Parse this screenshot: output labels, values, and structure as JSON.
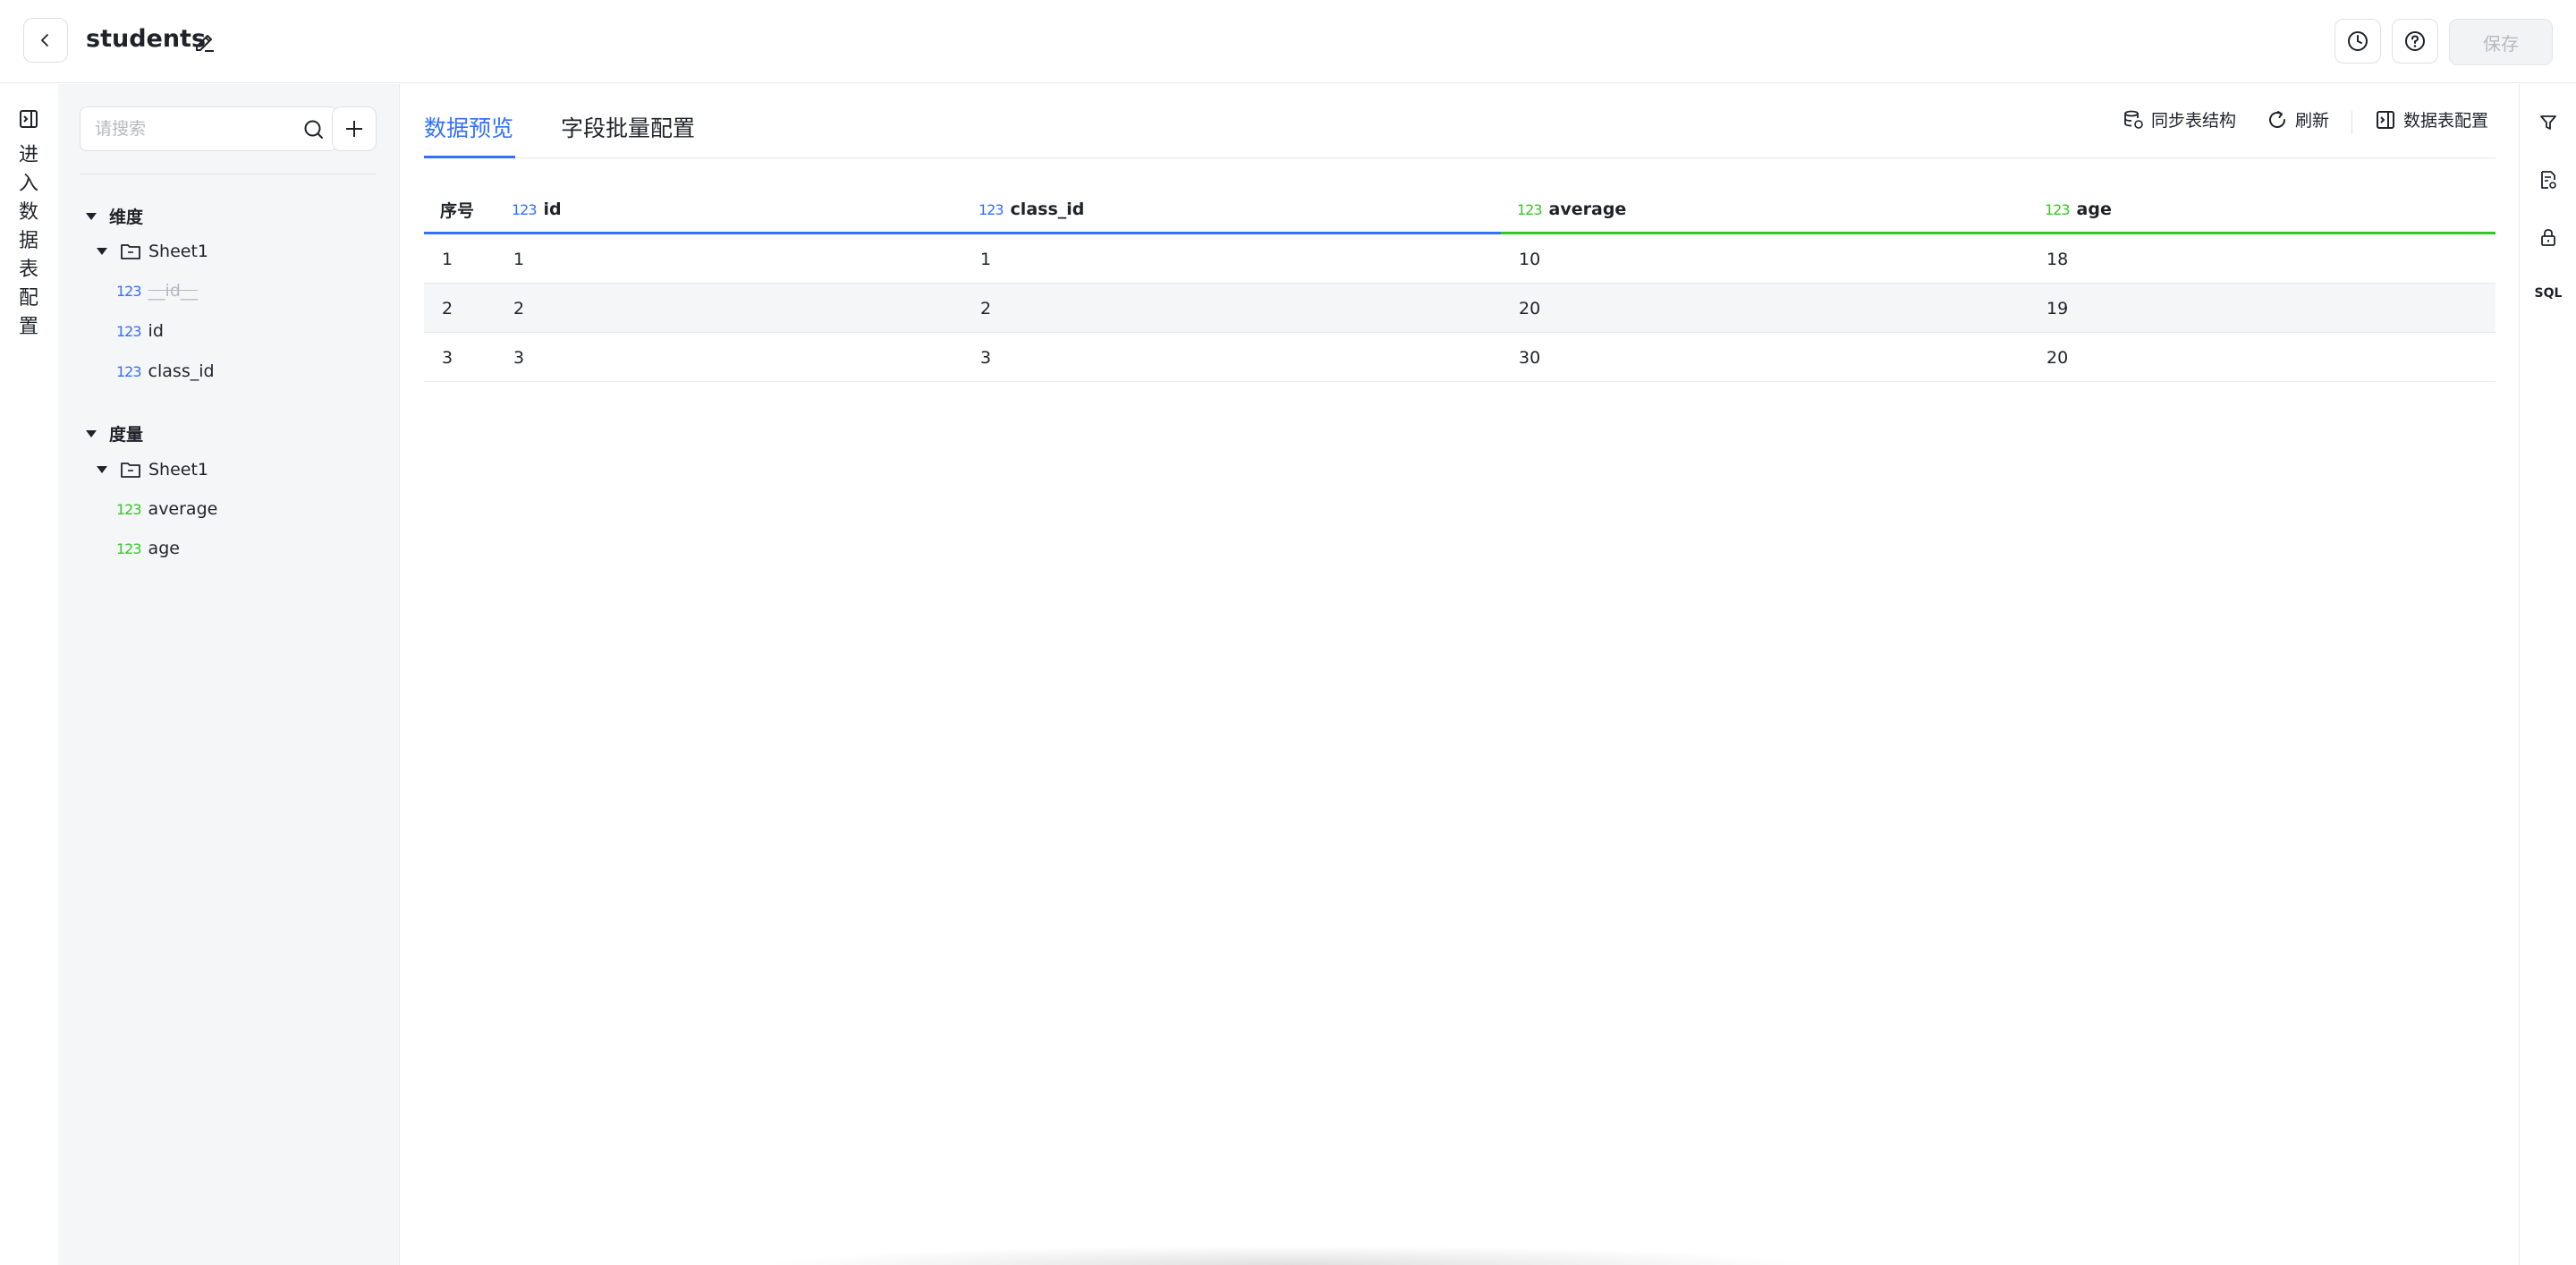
{
  "header": {
    "title": "students",
    "save_label": "保存"
  },
  "left_rail": {
    "label_chars": [
      "进",
      "入",
      "数",
      "据",
      "表",
      "配",
      "置"
    ]
  },
  "sidebar": {
    "search_placeholder": "请搜索",
    "dimension_group": {
      "label": "维度",
      "folder": "Sheet1",
      "fields": [
        {
          "type_badge": "123",
          "name": "__id__",
          "disabled": true
        },
        {
          "type_badge": "123",
          "name": "id"
        },
        {
          "type_badge": "123",
          "name": "class_id"
        }
      ]
    },
    "measure_group": {
      "label": "度量",
      "folder": "Sheet1",
      "fields": [
        {
          "type_badge": "123",
          "name": "average"
        },
        {
          "type_badge": "123",
          "name": "age"
        }
      ]
    }
  },
  "main": {
    "tabs": [
      {
        "label": "数据预览",
        "active": true
      },
      {
        "label": "字段批量配置",
        "active": false
      }
    ],
    "toolbar": {
      "sync_label": "同步表结构",
      "refresh_label": "刷新",
      "table_config_label": "数据表配置"
    },
    "table": {
      "index_header": "序号",
      "columns": [
        {
          "badge": "123",
          "name": "id",
          "kind": "dimension"
        },
        {
          "badge": "123",
          "name": "class_id",
          "kind": "dimension"
        },
        {
          "badge": "123",
          "name": "average",
          "kind": "measure"
        },
        {
          "badge": "123",
          "name": "age",
          "kind": "measure"
        }
      ],
      "rows": [
        [
          "1",
          "1",
          "1",
          "10",
          "18"
        ],
        [
          "2",
          "2",
          "2",
          "20",
          "19"
        ],
        [
          "3",
          "3",
          "3",
          "30",
          "20"
        ]
      ]
    }
  },
  "right_rail": {
    "sql_label": "SQL"
  },
  "colors": {
    "accent_blue": "#3370ff",
    "measure_green": "#34c724"
  }
}
